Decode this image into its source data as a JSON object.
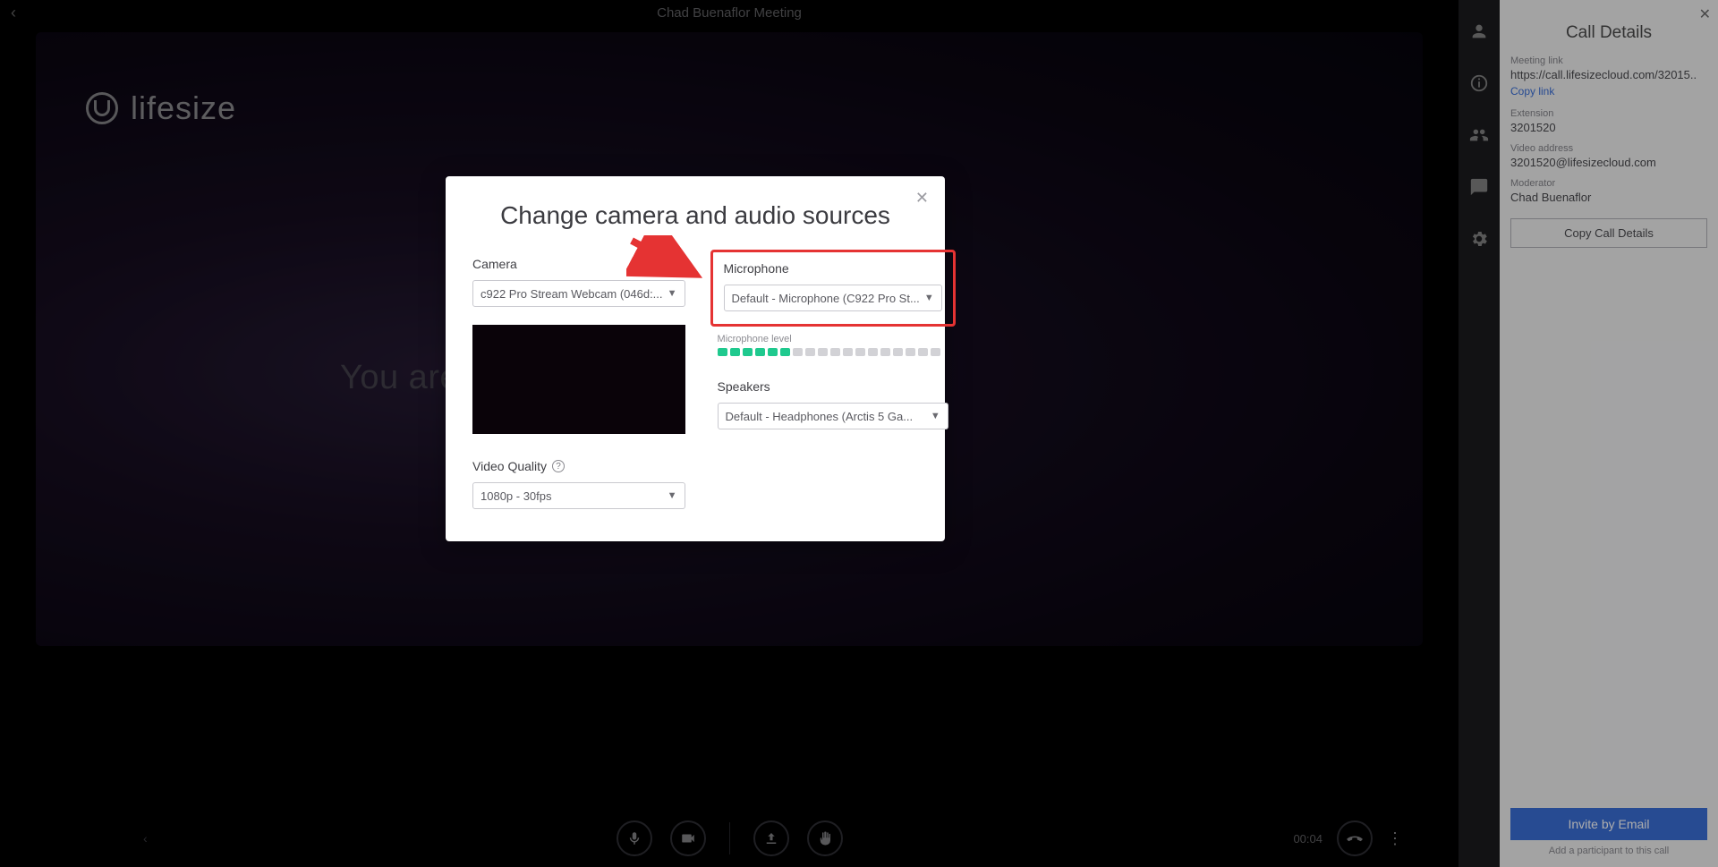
{
  "topbar": {
    "title": "Chad Buenaflor Meeting"
  },
  "logo": {
    "text": "lifesize"
  },
  "stage": {
    "only_participant_text": "You are the"
  },
  "controls": {
    "timer": "00:04"
  },
  "modal": {
    "title": "Change camera and audio sources",
    "camera": {
      "label": "Camera",
      "value": "c922 Pro Stream Webcam (046d:..."
    },
    "video_quality": {
      "label": "Video Quality",
      "value": "1080p - 30fps"
    },
    "microphone": {
      "label": "Microphone",
      "value": "Default - Microphone (C922 Pro St...",
      "level_label": "Microphone level",
      "active_segments": 6,
      "total_segments": 18
    },
    "speakers": {
      "label": "Speakers",
      "value": "Default - Headphones (Arctis 5 Ga..."
    }
  },
  "panel": {
    "title": "Call Details",
    "meeting_link": {
      "label": "Meeting link",
      "value": "https://call.lifesizecloud.com/32015..",
      "copy_text": "Copy link"
    },
    "extension": {
      "label": "Extension",
      "value": "3201520"
    },
    "video_address": {
      "label": "Video address",
      "value": "3201520@lifesizecloud.com"
    },
    "moderator": {
      "label": "Moderator",
      "value": "Chad Buenaflor"
    },
    "copy_button": "Copy Call Details",
    "invite_button": "Invite by Email",
    "footnote": "Add a participant to this call"
  }
}
